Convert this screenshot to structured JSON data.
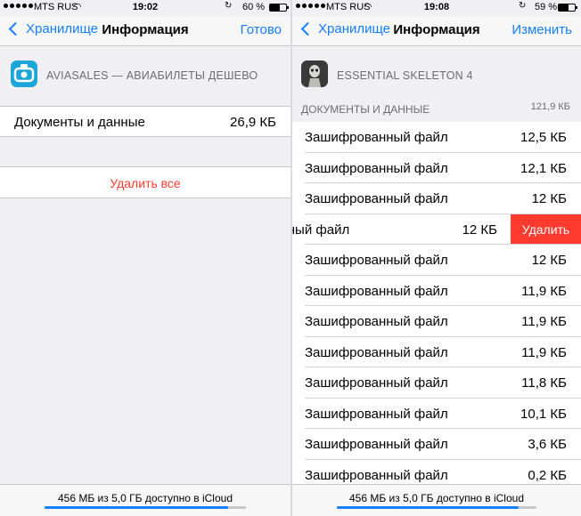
{
  "left": {
    "status": {
      "carrier": "MTS RUS",
      "time": "19:02",
      "battery": "60 %",
      "battery_level": 0.6
    },
    "nav": {
      "back": "Хранилище",
      "title": "Информация",
      "action": "Готово"
    },
    "app": {
      "name": "AVIASALES — АВИАБИЛЕТЫ ДЕШЕВО",
      "icon": "aviasales-app-icon"
    },
    "docs": {
      "label": "Документы и данные",
      "size": "26,9 КБ"
    },
    "delete_all": "Удалить все",
    "storage": {
      "text": "456 МБ из 5,0 ГБ доступно в iCloud",
      "used_fraction": 0.91
    }
  },
  "right": {
    "status": {
      "carrier": "MTS RUS",
      "time": "19:08",
      "battery": "59 %",
      "battery_level": 0.59
    },
    "nav": {
      "back": "Хранилище",
      "title": "Информация",
      "action": "Изменить"
    },
    "app": {
      "name": "ESSENTIAL SKELETON 4",
      "icon": "skeleton-app-icon"
    },
    "section": {
      "title": "ДОКУМЕНТЫ И ДАННЫЕ",
      "total": "121,9 КБ"
    },
    "files": [
      {
        "name": "Зашифрованный файл",
        "size": "12,5 КБ"
      },
      {
        "name": "Зашифрованный файл",
        "size": "12,1 КБ"
      },
      {
        "name": "Зашифрованный файл",
        "size": "12 КБ"
      },
      {
        "name": "ованный файл",
        "size": "12 КБ",
        "delete": "Удалить"
      },
      {
        "name": "Зашифрованный файл",
        "size": "12 КБ"
      },
      {
        "name": "Зашифрованный файл",
        "size": "11,9 КБ"
      },
      {
        "name": "Зашифрованный файл",
        "size": "11,9 КБ"
      },
      {
        "name": "Зашифрованный файл",
        "size": "11,9 КБ"
      },
      {
        "name": "Зашифрованный файл",
        "size": "11,8 КБ"
      },
      {
        "name": "Зашифрованный файл",
        "size": "10,1 КБ"
      },
      {
        "name": "Зашифрованный файл",
        "size": "3,6 КБ"
      },
      {
        "name": "Зашифрованный файл",
        "size": "0,2 КБ"
      }
    ],
    "storage": {
      "text": "456 МБ из 5,0 ГБ доступно в iCloud",
      "used_fraction": 0.91
    }
  },
  "colors": {
    "accent": "#147efb",
    "destructive": "#ff3b30",
    "background": "#efeff4"
  }
}
